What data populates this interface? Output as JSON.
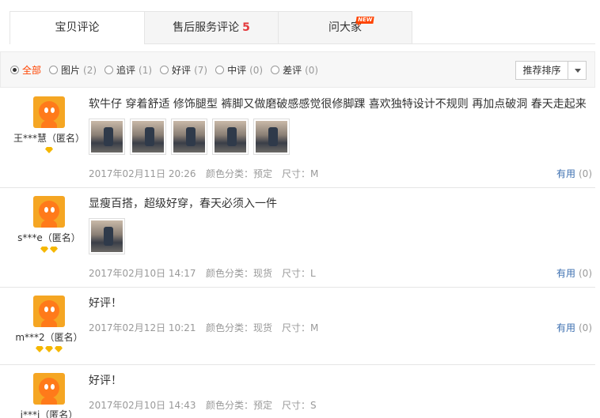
{
  "tabs": [
    {
      "label": "宝贝评论",
      "active": true
    },
    {
      "label": "售后服务评论",
      "count": "5"
    },
    {
      "label": "问大家",
      "badge": "NEW"
    }
  ],
  "filters": [
    {
      "label": "全部",
      "count": "",
      "checked": true
    },
    {
      "label": "图片",
      "count": "(2)"
    },
    {
      "label": "追评",
      "count": "(1)"
    },
    {
      "label": "好评",
      "count": "(7)"
    },
    {
      "label": "中评",
      "count": "(0)"
    },
    {
      "label": "差评",
      "count": "(0)"
    }
  ],
  "sort": {
    "label": "推荐排序"
  },
  "reviews": [
    {
      "user": "王***慧（匿名）",
      "diamonds": 1,
      "text": "软牛仔 穿着舒适 修饰腿型 裤脚又做磨破感感觉很修脚踝 喜欢独特设计不规则 再加点破洞 春天走起来",
      "photos": 5,
      "date": "2017年02月11日 20:26",
      "color": "颜色分类：预定",
      "size": "尺寸：M",
      "helpful_label": "有用",
      "helpful_count": "(0)"
    },
    {
      "user": "s***e（匿名）",
      "diamonds": 2,
      "text": "显瘦百搭，超级好穿，春天必须入一件",
      "photos": 1,
      "date": "2017年02月10日 14:17",
      "color": "颜色分类：现货",
      "size": "尺寸：L",
      "helpful_label": "有用",
      "helpful_count": "(0)"
    },
    {
      "user": "m***2（匿名）",
      "diamonds": 3,
      "text": "好评！",
      "photos": 0,
      "date": "2017年02月12日 10:21",
      "color": "颜色分类：现货",
      "size": "尺寸：M",
      "helpful_label": "有用",
      "helpful_count": "(0)"
    },
    {
      "user": "j***i（匿名）",
      "diamonds": 0,
      "text": "好评！",
      "photos": 0,
      "date": "2017年02月10日 14:43",
      "color": "颜色分类：预定",
      "size": "尺寸：S",
      "helpful_label": "",
      "helpful_count": ""
    }
  ]
}
